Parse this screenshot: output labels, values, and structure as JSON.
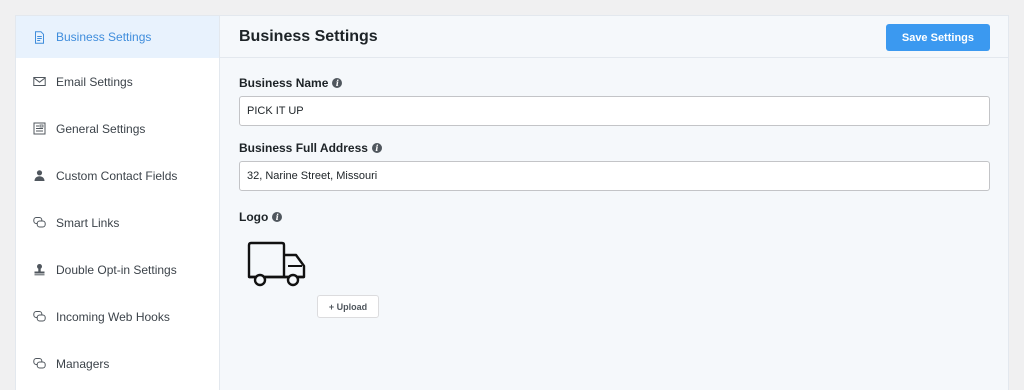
{
  "sidebar": {
    "items": [
      {
        "label": "Business Settings",
        "icon": "document-icon"
      },
      {
        "label": "Email Settings",
        "icon": "envelope-icon"
      },
      {
        "label": "General Settings",
        "icon": "settings-list-icon"
      },
      {
        "label": "Custom Contact Fields",
        "icon": "user-icon"
      },
      {
        "label": "Smart Links",
        "icon": "chat-bubbles-icon"
      },
      {
        "label": "Double Opt-in Settings",
        "icon": "stamp-icon"
      },
      {
        "label": "Incoming Web Hooks",
        "icon": "chat-bubbles-icon"
      },
      {
        "label": "Managers",
        "icon": "chat-bubbles-icon"
      }
    ],
    "active_index": 0
  },
  "header": {
    "title": "Business Settings",
    "save_label": "Save Settings"
  },
  "form": {
    "business_name": {
      "label": "Business Name",
      "value": "PICK IT UP"
    },
    "business_address": {
      "label": "Business Full Address",
      "value": "32, Narine Street, Missouri"
    },
    "logo": {
      "label": "Logo",
      "upload_label": "+ Upload",
      "image": "delivery-truck-icon"
    }
  },
  "colors": {
    "accent": "#3b99f0",
    "active_bg": "#e8f2fd",
    "active_text": "#3f8ddc"
  }
}
